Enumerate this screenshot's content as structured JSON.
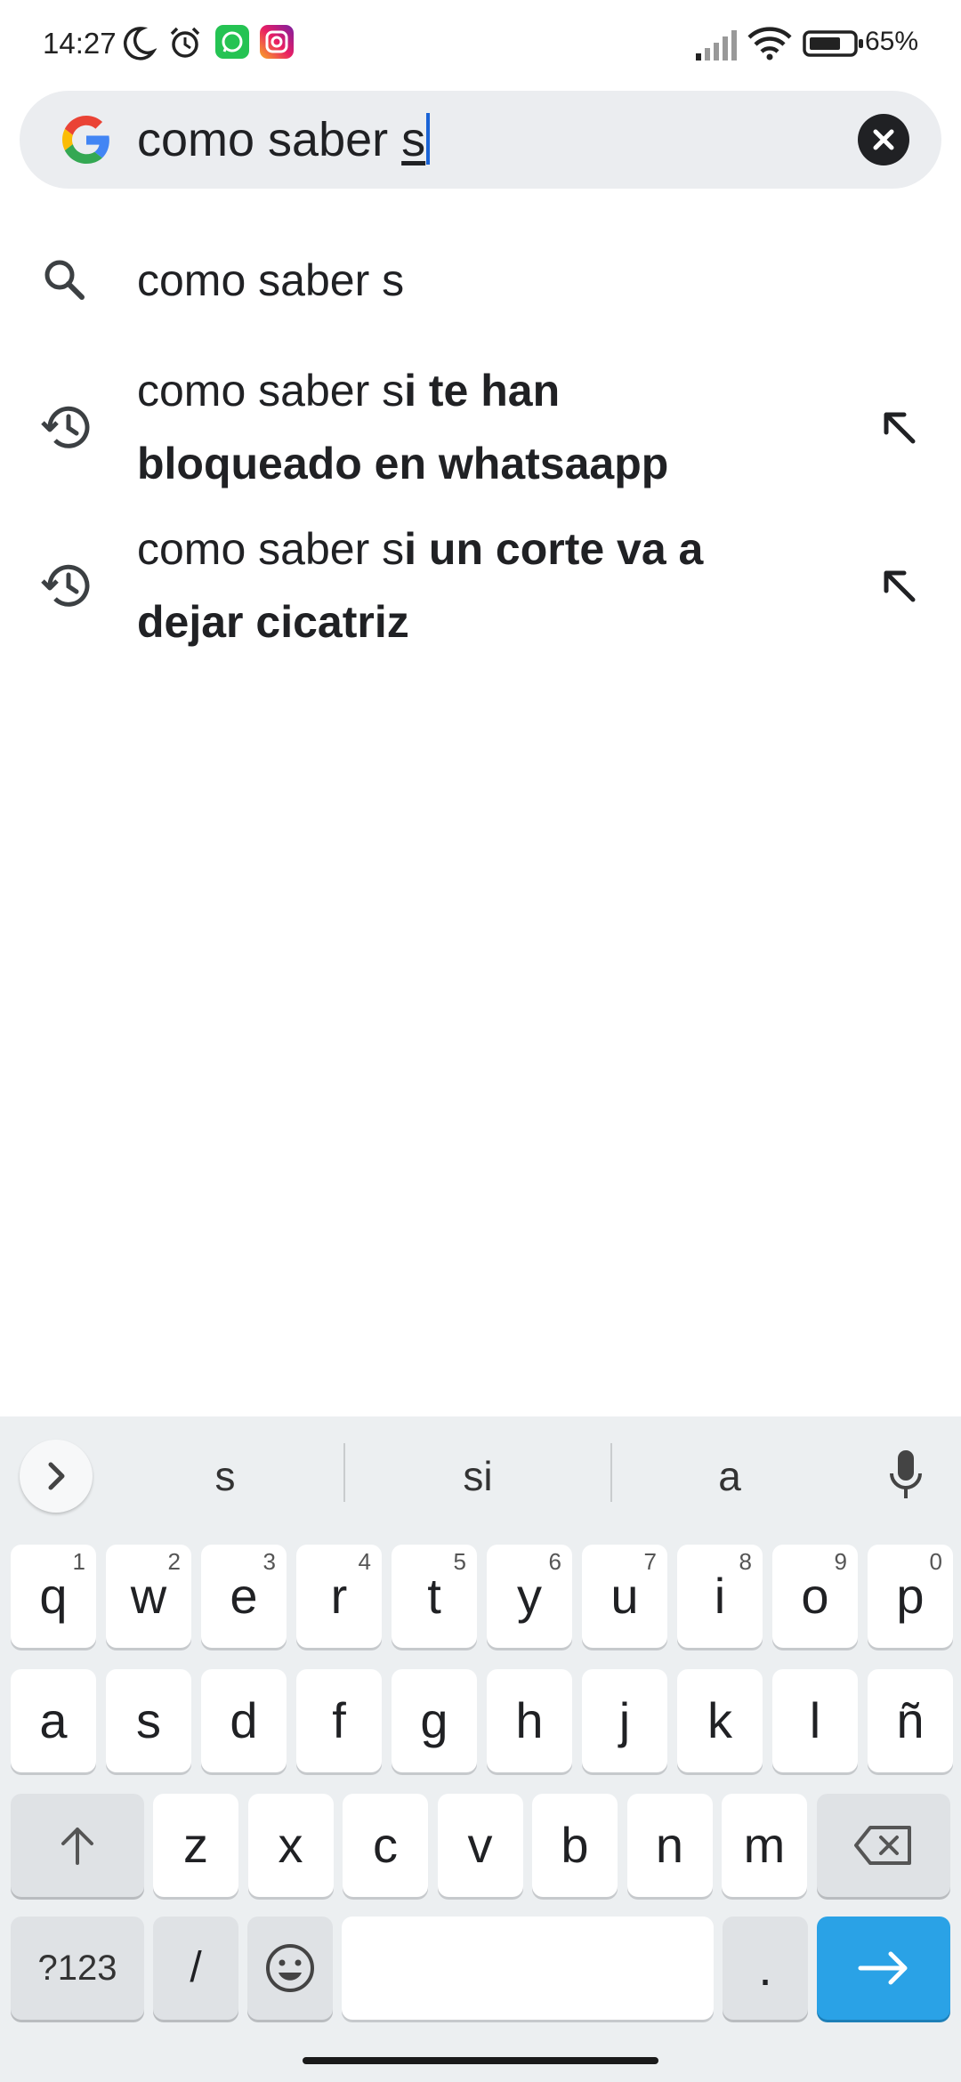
{
  "status_bar": {
    "time": "14:27",
    "battery_percent": "65%",
    "icons": [
      "moon-icon",
      "alarm-icon",
      "whatsapp-icon",
      "instagram-icon",
      "signal-icon",
      "wifi-icon",
      "battery-icon"
    ]
  },
  "search": {
    "query_prefix": "como saber ",
    "query_underlined": "s",
    "logo": "google-g-icon",
    "clear_icon": "close-icon"
  },
  "suggestions": [
    {
      "icon": "search-icon",
      "normal": "como saber s",
      "bold": "",
      "has_arrow": false
    },
    {
      "icon": "history-icon",
      "normal": "como saber s",
      "bold": "i te han bloqueado en whatsaapp",
      "has_arrow": true
    },
    {
      "icon": "history-icon",
      "normal": "como saber s",
      "bold": "i un corte va a dejar cicatriz",
      "has_arrow": true
    }
  ],
  "keyboard": {
    "candidates": [
      "s",
      "si",
      "a"
    ],
    "row1": [
      {
        "label": "q",
        "num": "1"
      },
      {
        "label": "w",
        "num": "2"
      },
      {
        "label": "e",
        "num": "3"
      },
      {
        "label": "r",
        "num": "4"
      },
      {
        "label": "t",
        "num": "5"
      },
      {
        "label": "y",
        "num": "6"
      },
      {
        "label": "u",
        "num": "7"
      },
      {
        "label": "i",
        "num": "8"
      },
      {
        "label": "o",
        "num": "9"
      },
      {
        "label": "p",
        "num": "0"
      }
    ],
    "row2": [
      "a",
      "s",
      "d",
      "f",
      "g",
      "h",
      "j",
      "k",
      "l",
      "ñ"
    ],
    "row3": [
      "z",
      "x",
      "c",
      "v",
      "b",
      "n",
      "m"
    ],
    "symbols_label": "?123",
    "slash_label": "/",
    "period_label": ".",
    "accent_color": "#2aa2e6"
  }
}
